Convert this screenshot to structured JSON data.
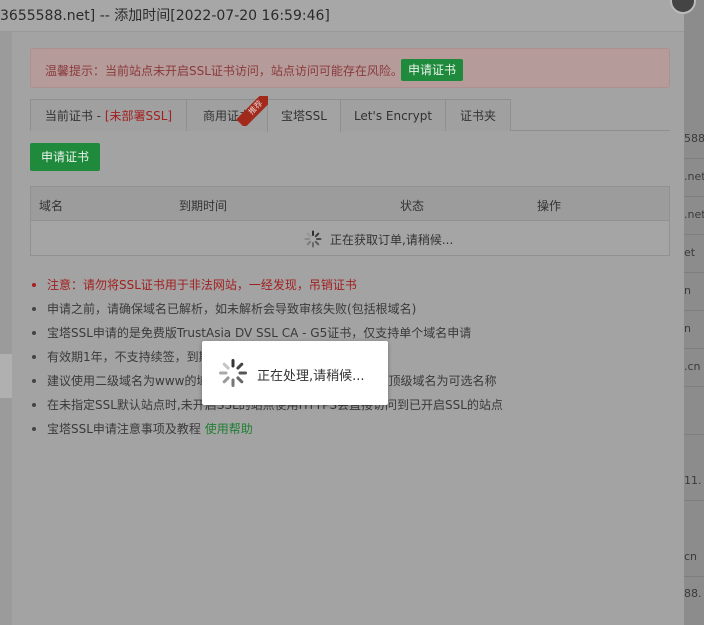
{
  "dialog": {
    "title": "3655588.net] -- 添加时间[2022-07-20 16:59:46]"
  },
  "alert": {
    "text": "温馨提示：当前站点未开启SSL证书访问，站点访问可能存在风险。",
    "button": "申请证书"
  },
  "tabs": [
    {
      "label": "当前证书 - ",
      "extra": "[未部署SSL]"
    },
    {
      "label": "商用证书",
      "ribbon": "推荐"
    },
    {
      "label": "宝塔SSL"
    },
    {
      "label": "Let's Encrypt"
    },
    {
      "label": "证书夹"
    }
  ],
  "apply_button": "申请证书",
  "table": {
    "columns": [
      "域名",
      "到期时间",
      "状态",
      "操作"
    ],
    "loading_text": "正在获取订单,请稍候..."
  },
  "notes": [
    "注意：请勿将SSL证书用于非法网站，一经发现，吊销证书",
    "申请之前，请确保域名已解析，如未解析会导致审核失败(包括根域名)",
    "宝塔SSL申请的是免费版TrustAsia DV SSL CA - G5证书，仅支持单个域名申请",
    "有效期1年，不支持续签，到期后需要重新申请",
    "建议使用二级域名为www的域名申请证书，此时系统会默认赠送顶级域名为可选名称",
    "在未指定SSL默认站点时,未开启SSL的站点使用HTTPS会直接访问到已开启SSL的站点",
    "宝塔SSL申请注意事项及教程 "
  ],
  "notes_link": "使用帮助",
  "toast": {
    "text": "正在处理,请稍候..."
  },
  "background_rows": [
    "588",
    ".net",
    ".net",
    "et",
    "n",
    "n",
    ".cn",
    "11.",
    "cn",
    "88."
  ]
}
